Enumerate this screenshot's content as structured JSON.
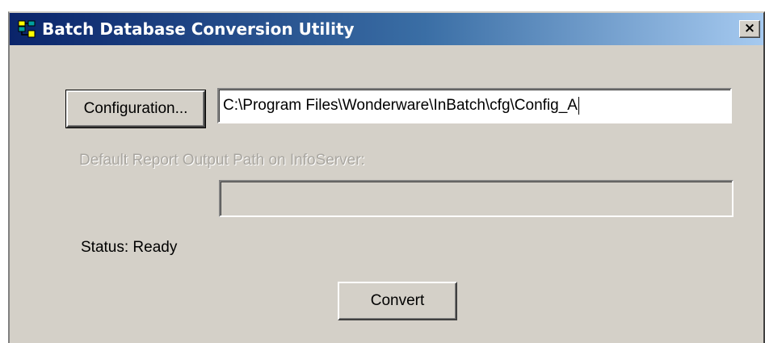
{
  "window": {
    "title": "Batch Database Conversion Utility",
    "close_label": "×",
    "app_icon": "database-conversion-icon",
    "colors": {
      "titlebar_start": "#0a246a",
      "titlebar_end": "#a6caf0",
      "face": "#d4d0c8"
    }
  },
  "config": {
    "button_label": "Configuration...",
    "path_value": "C:\\Program Files\\Wonderware\\InBatch\\cfg\\Config_A"
  },
  "report": {
    "label": "Default Report Output Path on InfoServer:",
    "path_value": ""
  },
  "status": {
    "text": "Status: Ready"
  },
  "actions": {
    "convert_label": "Convert"
  }
}
